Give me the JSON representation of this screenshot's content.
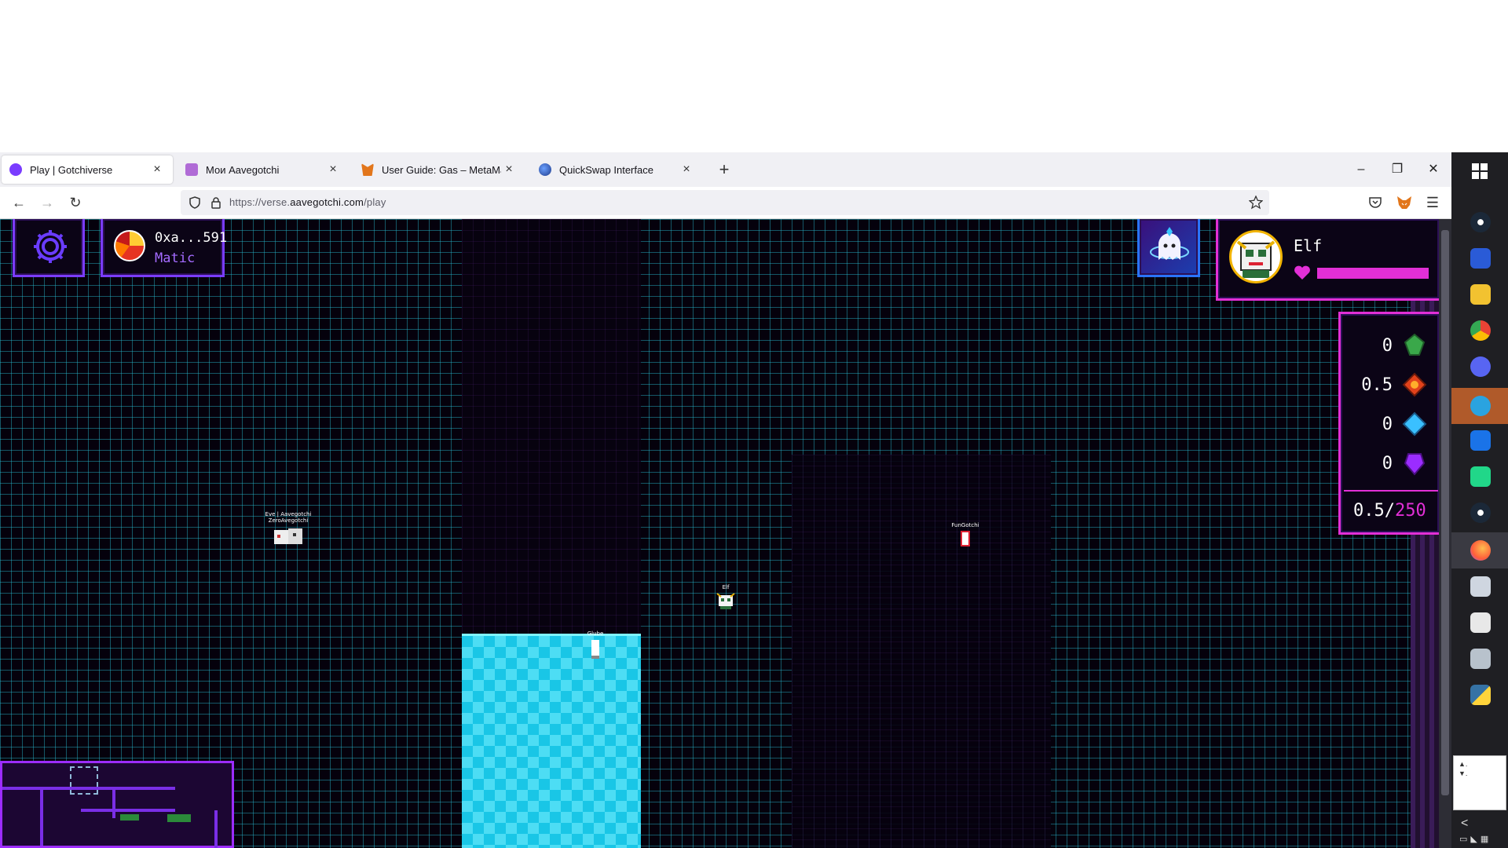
{
  "browser": {
    "tabs": [
      {
        "label": "Play | Gotchiverse",
        "active": true,
        "icon": "gotchi-favicon",
        "color": "#7a3cff"
      },
      {
        "label": "Мои Aavegotchi",
        "active": false,
        "icon": "aavegotchi-favicon",
        "color": "#b06bd6"
      },
      {
        "label": "User Guide: Gas – MetaMask",
        "active": false,
        "icon": "metamask-fox-favicon",
        "color": "#e2761b"
      },
      {
        "label": "QuickSwap Interface",
        "active": false,
        "icon": "quickswap-favicon",
        "color": "#1f3a8a"
      }
    ],
    "url": {
      "prefix": "https://verse.",
      "domain": "aavegotchi.com",
      "path": "/play"
    }
  },
  "hud": {
    "wallet": {
      "address": "0xa...591",
      "network": "Matic"
    },
    "gotchi": {
      "name": "Elf",
      "health": 1.0
    },
    "resources": [
      {
        "value": "0",
        "icon": "fud-green-gem-icon",
        "color": "#3aa84a"
      },
      {
        "value": "0.5",
        "icon": "fomo-red-gem-icon",
        "color": "#e2421b"
      },
      {
        "value": "0",
        "icon": "alpha-blue-gem-icon",
        "color": "#3ac0ff"
      },
      {
        "value": "0",
        "icon": "kek-purple-gem-icon",
        "color": "#9b2cff"
      }
    ],
    "capacity": {
      "current": "0.5",
      "separator": "/",
      "max": "250"
    }
  },
  "players": [
    {
      "name": "Eve | Aavegotchi",
      "subname": "ZeroAvegotchi"
    },
    {
      "name": "FunGotchi"
    },
    {
      "name": "Elf"
    },
    {
      "name": "Glube"
    }
  ],
  "tray": {
    "line1": "▲.",
    "line2": "▼."
  }
}
